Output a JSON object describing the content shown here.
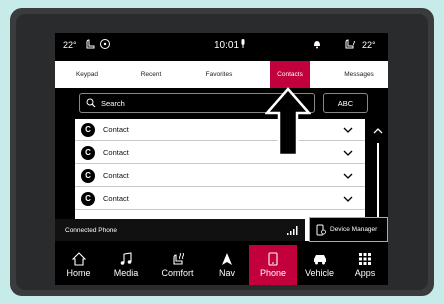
{
  "status": {
    "temp_left": "22°",
    "temp_right": "22°",
    "time": "10:01"
  },
  "tabs": [
    {
      "label": "Keypad"
    },
    {
      "label": "Recent"
    },
    {
      "label": "Favorites"
    },
    {
      "label": "Contacts",
      "active": true
    },
    {
      "label": "Messages"
    }
  ],
  "search": {
    "label": "Search",
    "abc_label": "ABC"
  },
  "contacts": [
    {
      "initial": "C",
      "name": "Contact"
    },
    {
      "initial": "C",
      "name": "Contact"
    },
    {
      "initial": "C",
      "name": "Contact"
    },
    {
      "initial": "C",
      "name": "Contact"
    }
  ],
  "footer": {
    "connected_phone": "Connected Phone",
    "device_manager": "Device Manager"
  },
  "nav": [
    {
      "label": "Home",
      "icon": "home-icon"
    },
    {
      "label": "Media",
      "icon": "music-note-icon"
    },
    {
      "label": "Comfort",
      "icon": "heated-seat-icon"
    },
    {
      "label": "Nav",
      "icon": "navigation-arrow-icon"
    },
    {
      "label": "Phone",
      "icon": "phone-icon",
      "active": true
    },
    {
      "label": "Vehicle",
      "icon": "car-icon"
    },
    {
      "label": "Apps",
      "icon": "apps-grid-icon"
    }
  ],
  "colors": {
    "accent": "#c2003b",
    "background": "#c7ebe8",
    "screen": "#000000"
  }
}
